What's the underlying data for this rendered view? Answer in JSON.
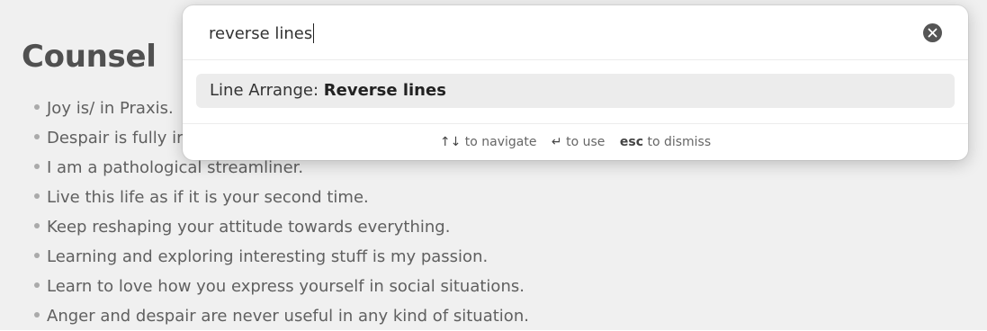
{
  "note": {
    "title": "Counsel",
    "items": [
      "Joy is/ in Praxis.",
      "Despair is fully irrational.",
      "I am a pathological streamliner.",
      "Live this life as if it is your second time.",
      "Keep reshaping your attitude towards everything.",
      "Learning and exploring interesting stuff is my passion.",
      "Learn to love how you express yourself in social situations.",
      "Anger and despair are never useful in any kind of situation."
    ]
  },
  "palette": {
    "query": "reverse lines",
    "clear_icon": "close-circle-icon",
    "results": [
      {
        "prefix": "Line Arrange: ",
        "match": "Reverse lines",
        "selected": true
      }
    ],
    "footer": {
      "navigate_key": "↑↓",
      "navigate_label": "to navigate",
      "use_key": "↵",
      "use_label": "to use",
      "dismiss_key": "esc",
      "dismiss_label": "to dismiss"
    }
  },
  "colors": {
    "selected_bg": "#ececec",
    "bullet": "#b5b5b5",
    "text": "#666666"
  }
}
